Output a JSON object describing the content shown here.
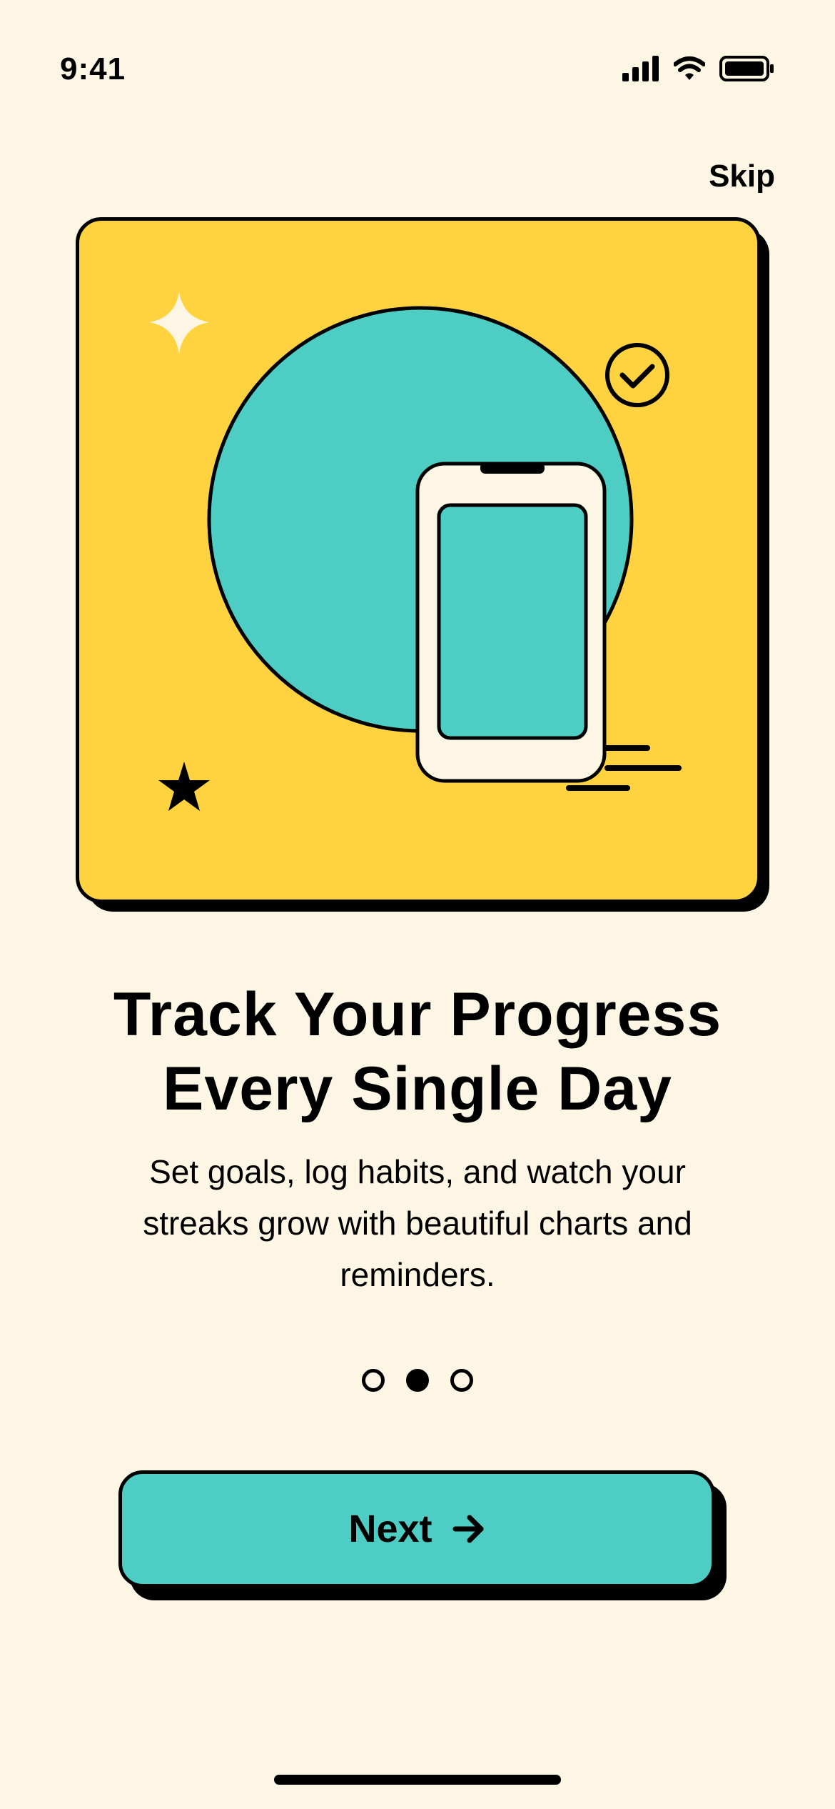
{
  "status_bar": {
    "time": "9:41",
    "icons": [
      "cellular-signal-icon",
      "wifi-icon",
      "battery-icon"
    ]
  },
  "header": {
    "skip_label": "Skip"
  },
  "hero": {
    "icons": [
      "sparkle-icon",
      "checkmark-circle-icon",
      "phone-icon",
      "star-icon",
      "motion-lines-icon"
    ]
  },
  "content": {
    "title_line1": "Track Your Progress",
    "title_line2": "Every Single Day",
    "description": "Set goals, log habits, and watch your streaks grow with beautiful charts and reminders."
  },
  "pagination": {
    "total": 3,
    "active_index": 1
  },
  "footer": {
    "next_label": "Next",
    "next_icon": "arrow-right-icon"
  },
  "colors": {
    "background": "#FDF6E4",
    "card": "#FFD33F",
    "accent": "#4ECDC4",
    "ink": "#000000",
    "phone_body": "#FDF6E4"
  }
}
